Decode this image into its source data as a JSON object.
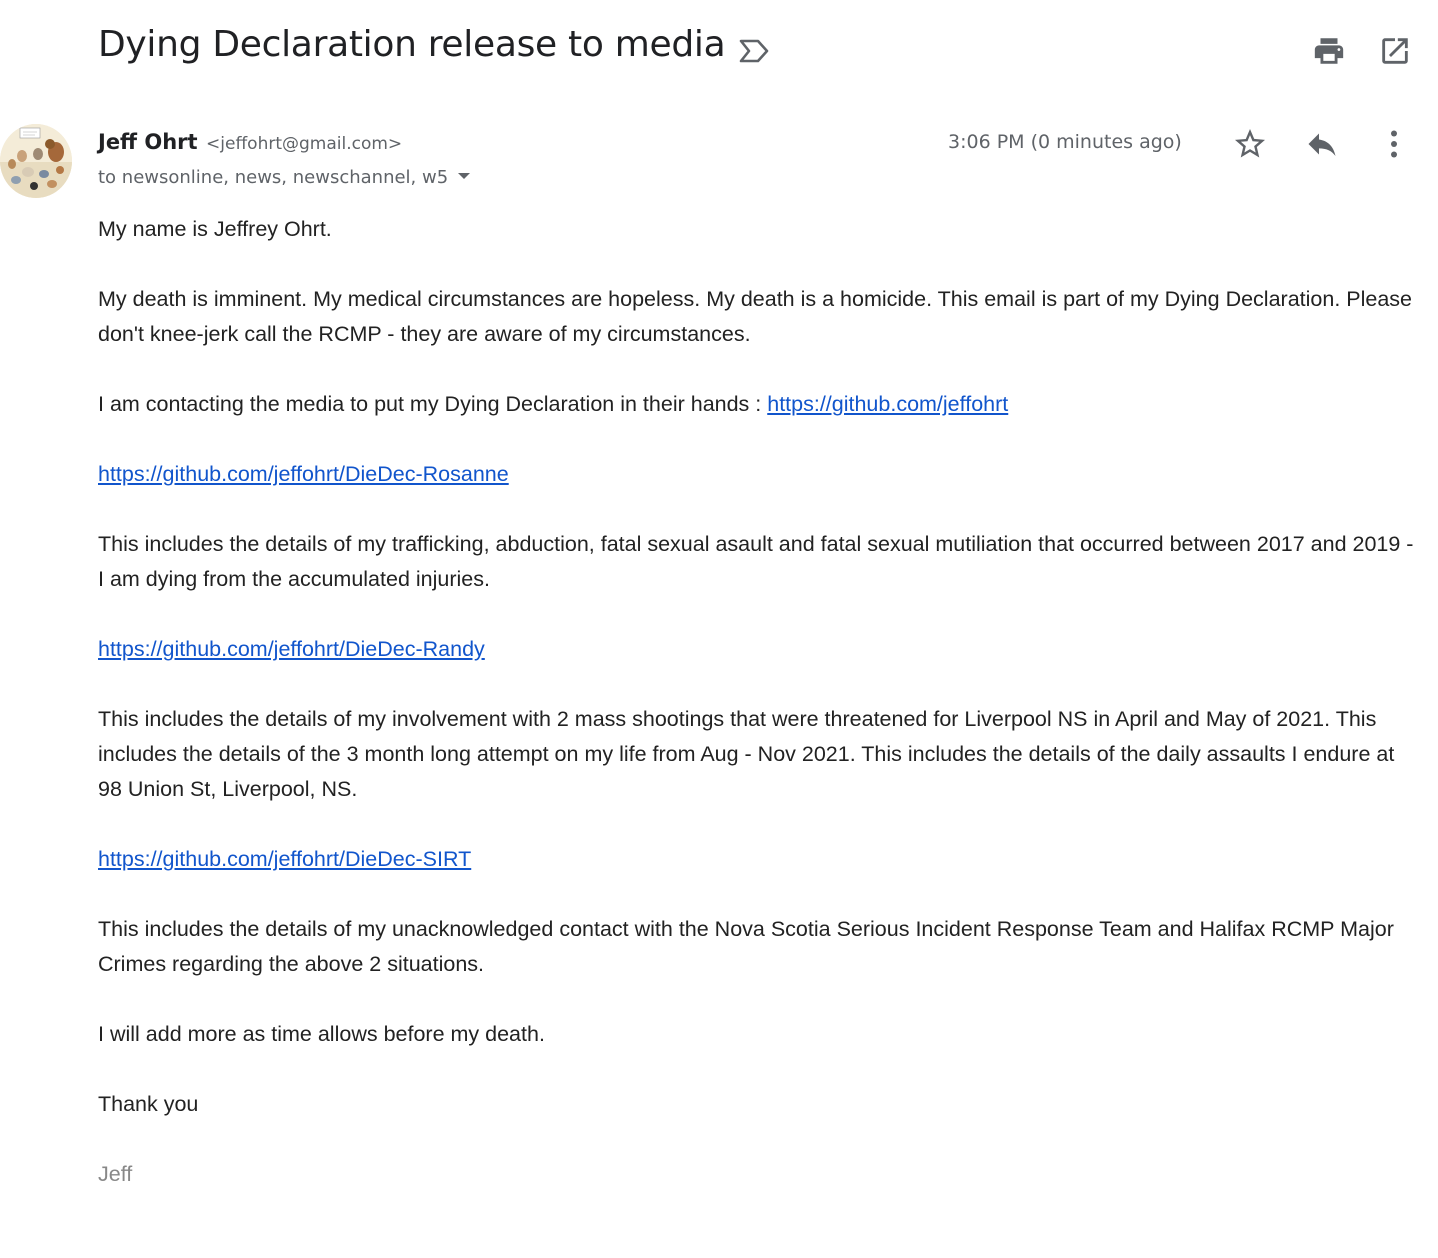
{
  "message": {
    "subject": "Dying Declaration release to media",
    "sender_name": "Jeff Ohrt",
    "sender_email": "<jeffohrt@gmail.com>",
    "recipients": "to newsonline, news, newschannel, w5",
    "timestamp": "3:06 PM (0 minutes ago)"
  },
  "icons": {
    "label": "label-icon",
    "print": "print-icon",
    "new_window": "open-in-new-window-icon",
    "star": "star-icon",
    "reply": "reply-icon",
    "more": "more-vert-icon",
    "recipients_toggle": "caret-down-icon"
  },
  "body": {
    "p1": "My name is Jeffrey Ohrt.",
    "p2": "My death is imminent.  My medical circumstances are hopeless.  My death is a homicide.  This email is part of my Dying Declaration.  Please don't knee-jerk call the RCMP - they are aware of my circumstances.",
    "p3_text": "I am contacting the media to put my Dying Declaration in their hands : ",
    "p3_link": "https://github.com/jeffohrt",
    "link_rosanne": "https://github.com/jeffohrt/DieDec-Rosanne",
    "p4": "This includes the details of my trafficking, abduction, fatal sexual asault and fatal sexual mutiliation that occurred between 2017 and 2019 - I am dying from the accumulated injuries.",
    "link_randy": "https://github.com/jeffohrt/DieDec-Randy",
    "p5": "This includes the details of my involvement with 2 mass shootings that were threatened for Liverpool NS in April and May of 2021.  This includes the details of the 3 month long attempt on my life from Aug - Nov 2021.  This includes the details of the daily assaults I endure at 98 Union St, Liverpool, NS.",
    "link_sirt": "https://github.com/jeffohrt/DieDec-SIRT",
    "p6": "This includes the details of my unacknowledged contact with the Nova Scotia Serious Incident Response Team and Halifax RCMP Major Crimes regarding the above 2 situations.",
    "p7": "I will add more as time allows before my death.",
    "p8": "Thank you",
    "signature": "Jeff"
  },
  "colors": {
    "link": "#1155cc",
    "icon": "#5f6368",
    "signature": "#888888"
  }
}
